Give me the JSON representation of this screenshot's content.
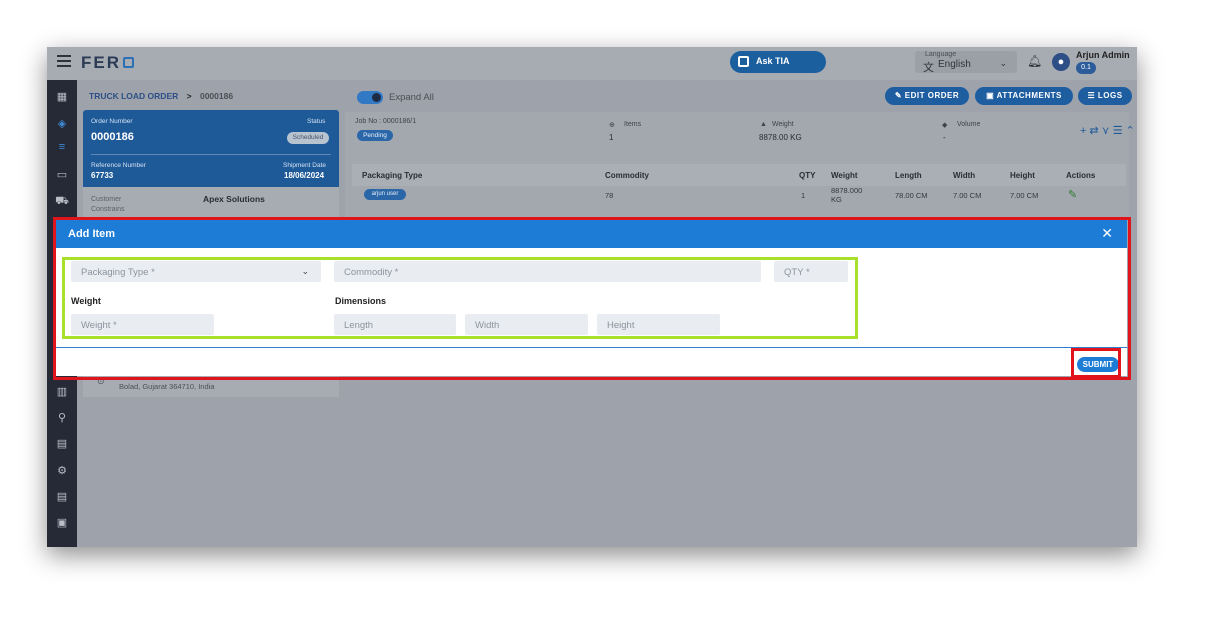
{
  "app": {
    "logo": "FER",
    "ask_tia": "Ask TIA",
    "language_caption": "Language",
    "language_value": "English",
    "user_name": "Arjun Admin",
    "user_version": "0.1"
  },
  "breadcrumb": {
    "section": "TRUCK LOAD ORDER",
    "separator": ">",
    "order_id": "0000186"
  },
  "order_card": {
    "order_number_label": "Order Number",
    "order_number": "0000186",
    "status_label": "Status",
    "status": "Scheduled",
    "reference_label": "Reference Number",
    "reference": "67733",
    "shipment_date_label": "Shipment Date",
    "shipment_date": "18/06/2024",
    "customer_label": "Customer",
    "customer": "Apex Solutions",
    "constrains_label": "Constrains",
    "address": "Bolad, Gujarat 364710, India"
  },
  "toolbar": {
    "expand_all": "Expand All",
    "edit_order": "EDIT ORDER",
    "attachments": "ATTACHMENTS",
    "logs": "LOGS"
  },
  "job": {
    "job_no_label": "Job No : 0000186/1",
    "status": "Pending",
    "items_label": "Items",
    "items_value": "1",
    "weight_label": "Weight",
    "weight_value": "8878.00 KG",
    "volume_label": "Volume",
    "volume_value": "-"
  },
  "table": {
    "headers": [
      "Packaging Type",
      "Commodity",
      "QTY",
      "Weight",
      "Length",
      "Width",
      "Height",
      "Actions"
    ],
    "rows": [
      {
        "packaging_type": "arjun user",
        "commodity": "78",
        "qty": "1",
        "weight": "8878.000 KG",
        "length": "78.00 CM",
        "width": "7.00 CM",
        "height": "7.00 CM"
      }
    ]
  },
  "modal": {
    "title": "Add Item",
    "close": "✕",
    "packaging_type_placeholder": "Packaging Type *",
    "commodity_placeholder": "Commodity *",
    "qty_placeholder": "QTY *",
    "weight_section": "Weight",
    "dimensions_section": "Dimensions",
    "weight_placeholder": "Weight *",
    "length_placeholder": "Length",
    "width_placeholder": "Width",
    "height_placeholder": "Height",
    "submit": "SUBMIT"
  },
  "colors": {
    "brand_blue": "#1d7cd6",
    "annotation_red": "#e1141b",
    "annotation_green": "#a8e02b"
  }
}
